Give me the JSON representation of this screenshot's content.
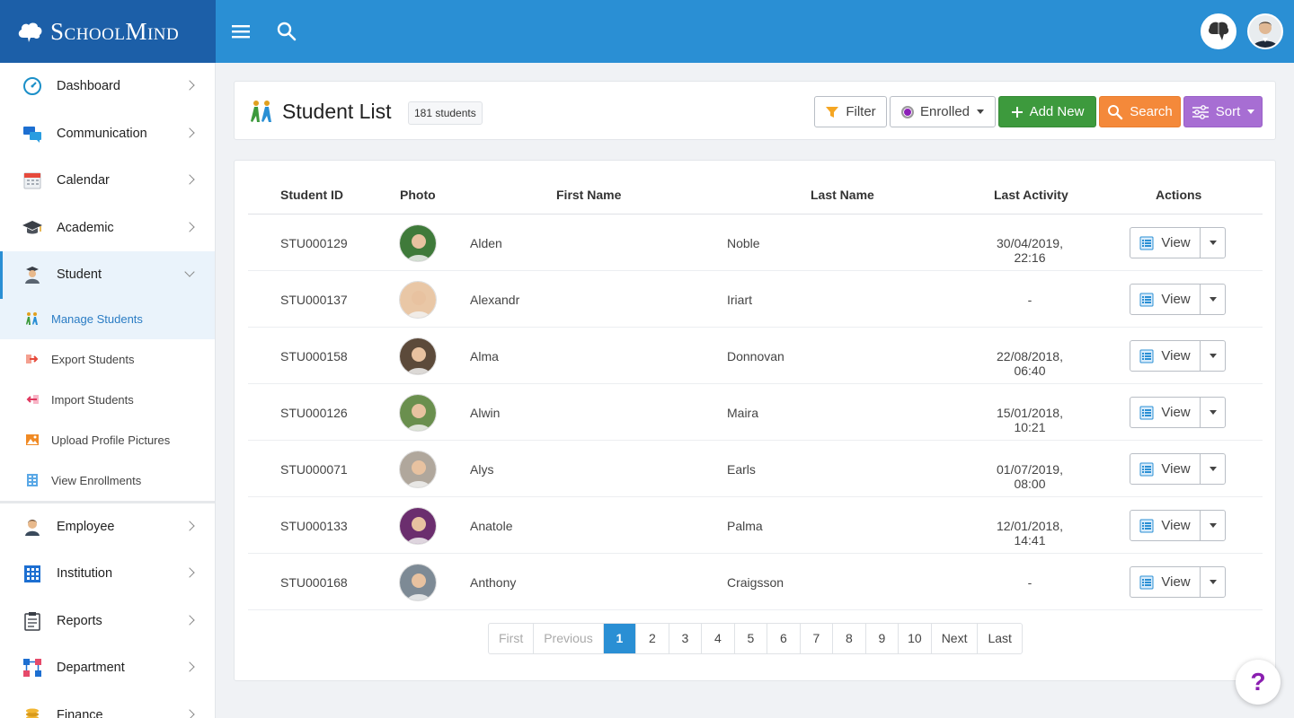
{
  "brand": {
    "name": "SchoolMind"
  },
  "topbar": {
    "menu_icon": "hamburger-icon",
    "search_icon": "search-icon"
  },
  "sidebar": {
    "items": [
      {
        "label": "Dashboard",
        "icon": "dashboard-gauge-icon"
      },
      {
        "label": "Communication",
        "icon": "chat-bubbles-icon"
      },
      {
        "label": "Calendar",
        "icon": "calendar-icon"
      },
      {
        "label": "Academic",
        "icon": "graduation-cap-icon"
      },
      {
        "label": "Student",
        "icon": "student-icon"
      }
    ],
    "student_sub": [
      {
        "label": "Manage Students",
        "icon": "students-walking-icon"
      },
      {
        "label": "Export Students",
        "icon": "export-arrow-icon"
      },
      {
        "label": "Import Students",
        "icon": "import-arrow-icon"
      },
      {
        "label": "Upload Profile Pictures",
        "icon": "image-icon"
      },
      {
        "label": "View Enrollments",
        "icon": "enrollments-icon"
      }
    ],
    "items_after": [
      {
        "label": "Employee",
        "icon": "employee-icon"
      },
      {
        "label": "Institution",
        "icon": "building-icon"
      },
      {
        "label": "Reports",
        "icon": "clipboard-icon"
      },
      {
        "label": "Department",
        "icon": "hierarchy-icon"
      },
      {
        "label": "Finance",
        "icon": "coins-icon"
      }
    ]
  },
  "header": {
    "title": "Student List",
    "count": "181 students",
    "filter_label": "Filter",
    "enrolled_label": "Enrolled",
    "add_label": "Add New",
    "search_label": "Search",
    "sort_label": "Sort"
  },
  "table": {
    "columns": [
      "Student ID",
      "Photo",
      "First Name",
      "Last Name",
      "Last Activity",
      "Actions"
    ],
    "view_label": "View",
    "rows": [
      {
        "id": "STU000129",
        "first": "Alden",
        "last": "Noble",
        "activity": "30/04/2019, 22:16",
        "photo": "#3f7a3a"
      },
      {
        "id": "STU000137",
        "first": "Alexandr",
        "last": "Iriart",
        "activity": "-",
        "photo": "#e9c7a6"
      },
      {
        "id": "STU000158",
        "first": "Alma",
        "last": "Donnovan",
        "activity": "22/08/2018, 06:40",
        "photo": "#5c4a3a"
      },
      {
        "id": "STU000126",
        "first": "Alwin",
        "last": "Maira",
        "activity": "15/01/2018, 10:21",
        "photo": "#6a8f4e"
      },
      {
        "id": "STU000071",
        "first": "Alys",
        "last": "Earls",
        "activity": "01/07/2019, 08:00",
        "photo": "#b0a79c"
      },
      {
        "id": "STU000133",
        "first": "Anatole",
        "last": "Palma",
        "activity": "12/01/2018, 14:41",
        "photo": "#6b2e6e"
      },
      {
        "id": "STU000168",
        "first": "Anthony",
        "last": "Craigsson",
        "activity": "-",
        "photo": "#7d8a95"
      }
    ]
  },
  "pagination": {
    "first": "First",
    "previous": "Previous",
    "pages": [
      "1",
      "2",
      "3",
      "4",
      "5",
      "6",
      "7",
      "8",
      "9",
      "10"
    ],
    "next": "Next",
    "last": "Last",
    "current": "1"
  },
  "help": {
    "label": "?"
  },
  "colors": {
    "brand_dark": "#1c5fa8",
    "topbar": "#2a8fd4",
    "add": "#3d9a3d",
    "search": "#f4893a",
    "sort": "#a76ed3",
    "enrolled_dot": "#8b1fb7"
  }
}
